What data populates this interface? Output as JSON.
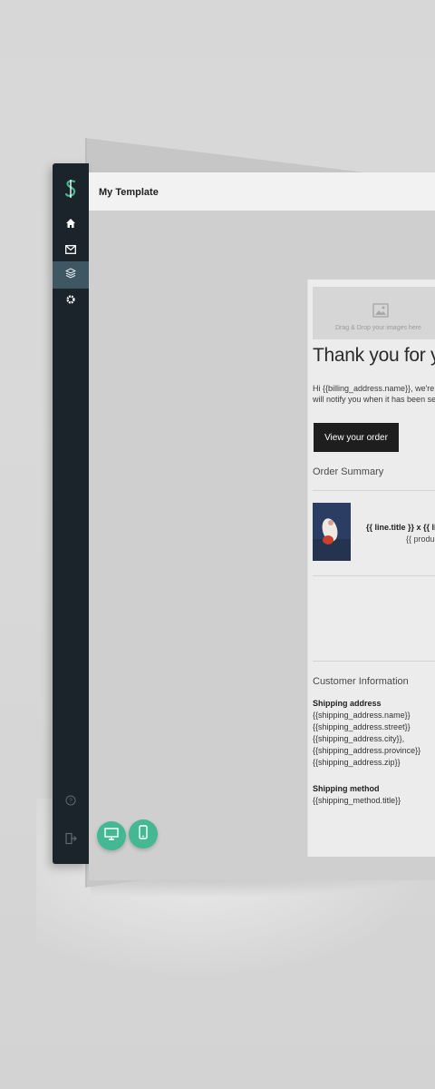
{
  "app": {
    "title": "My Template"
  },
  "sidebar": {
    "logo": "brand-logo",
    "items": [
      {
        "name": "home",
        "icon": "home-icon"
      },
      {
        "name": "mail",
        "icon": "mail-icon"
      },
      {
        "name": "templates",
        "icon": "layers-icon",
        "active": true
      },
      {
        "name": "settings",
        "icon": "gear-icon"
      }
    ],
    "bottom": [
      {
        "name": "help",
        "icon": "help-icon"
      },
      {
        "name": "logout",
        "icon": "logout-icon"
      }
    ]
  },
  "email": {
    "dropzone_text": "Drag & Drop your images here",
    "heading": "Thank you for you",
    "intro_line1": "Hi {{billing_address.name}}, we're g",
    "intro_line2": "will notify you when it has been sen",
    "cta_label": "View your order",
    "order_summary_title": "Order Summary",
    "line_title": "{{ line.title }} x {{ lin",
    "line_product": "{{ produc",
    "customer_info_title": "Customer Information",
    "shipping_address_label": "Shipping address",
    "shipping_address_lines": [
      "{{shipping_address.name}}",
      "{{shipping_address.street}}",
      "{{shipping_address.city}},",
      "{{shipping_address.province}}",
      "{{shipping_address.zip}}"
    ],
    "shipping_method_label": "Shipping method",
    "shipping_method_value": "{{shipping_method.title}}"
  },
  "preview_buttons": [
    {
      "name": "desktop-preview",
      "icon": "monitor-icon"
    },
    {
      "name": "mobile-preview",
      "icon": "phone-icon"
    }
  ],
  "colors": {
    "sidebar_bg": "#1b242b",
    "sidebar_active": "#3f5663",
    "accent": "#43b892",
    "cta_bg": "#1e1e1e"
  }
}
